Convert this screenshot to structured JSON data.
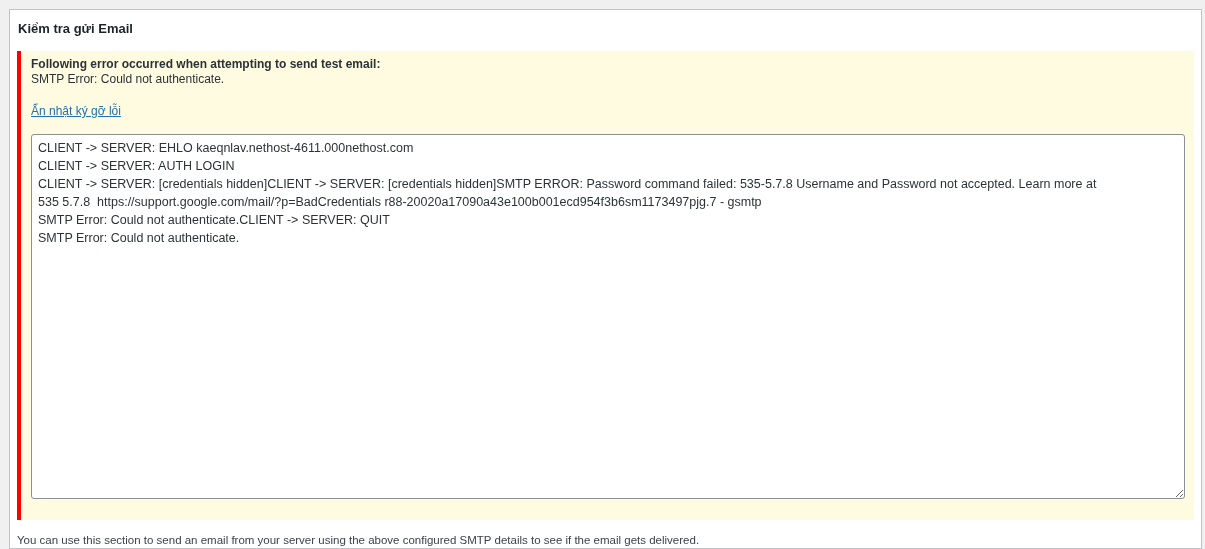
{
  "section_title": "Kiểm tra gửi Email",
  "notice": {
    "heading": "Following error occurred when attempting to send test email:",
    "message": "SMTP Error: Could not authenticate.",
    "toggle_link": "Ẩn nhật ký gỡ lỗi",
    "log_lines": [
      "CLIENT -> SERVER: EHLO kaeqnlav.nethost-4611.000nethost.com",
      "CLIENT -> SERVER: AUTH LOGIN",
      "CLIENT -> SERVER: [credentials hidden]CLIENT -> SERVER: [credentials hidden]SMTP ERROR: Password command failed: 535-5.7.8 Username and Password not accepted. Learn more at",
      "535 5.7.8  https://support.google.com/mail/?p=BadCredentials r88-20020a17090a43e100b001ecd954f3b6sm1173497pjg.7 - gsmtp",
      "SMTP Error: Could not authenticate.CLIENT -> SERVER: QUIT",
      "SMTP Error: Could not authenticate."
    ]
  },
  "description": "You can use this section to send an email from your server using the above configured SMTP details to see if the email gets delivered."
}
